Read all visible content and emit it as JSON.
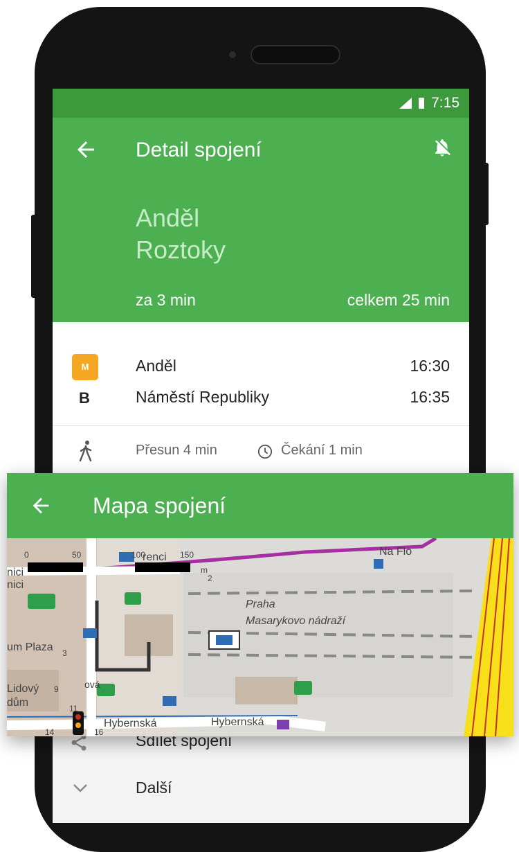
{
  "status_bar": {
    "time": "7:15"
  },
  "header": {
    "title": "Detail spojení"
  },
  "route": {
    "from": "Anděl",
    "to": "Roztoky",
    "departure_in": "za 3 min",
    "total": "celkem 25 min"
  },
  "segment": {
    "metro_logo": "M",
    "line": "B",
    "stops": [
      {
        "name": "Anděl",
        "time": "16:30"
      },
      {
        "name": "Náměstí Republiky",
        "time": "16:35"
      }
    ],
    "transfer": "Přesun 4 min",
    "waiting": "Čekání 1 min"
  },
  "menu": {
    "share": "Sdílet spojení",
    "more": "Další"
  },
  "map_overlay": {
    "title": "Mapa spojení",
    "labels": {
      "station_line1": "Praha",
      "station_line2": "Masarykovo nádraží",
      "street_na_fl": "Na Flo",
      "street_hybernska_1": "Hybernská",
      "street_hybernska_2": "Hybernská",
      "plaza": "um Plaza",
      "lidovy": "Lidový",
      "dum": "dům",
      "renci": "renci",
      "n_ici_1": "nici",
      "n_ici_2": "nici",
      "m": "m",
      "nova": "ová",
      "num_0": "0",
      "num_50": "50",
      "num_100": "100",
      "num_150": "150",
      "num_2": "2",
      "num_3": "3",
      "num_9": "9",
      "num_11": "11",
      "num_14": "14",
      "num_16": "16"
    },
    "colors": {
      "tram_line": "#a52fa0",
      "rail_yellow": "#f7e01a",
      "building": "#c8b8a8",
      "green_icon": "#2e9e4a"
    }
  }
}
